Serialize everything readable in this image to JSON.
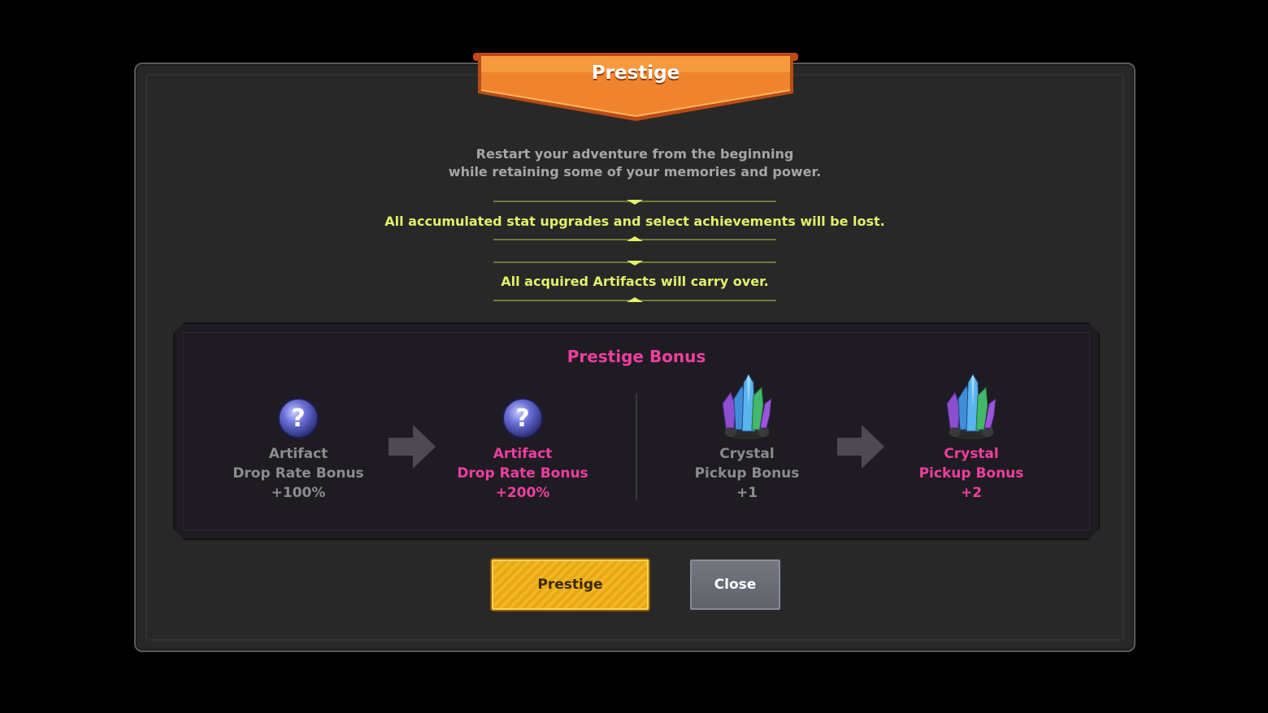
{
  "dialog": {
    "title": "Prestige",
    "description_line1": "Restart your adventure from the beginning",
    "description_line2": "while retaining some of your memories and power.",
    "warning": "All accumulated stat upgrades and select achievements will be lost.",
    "carry_over": "All acquired Artifacts will carry over."
  },
  "bonus": {
    "title": "Prestige Bonus",
    "items": [
      {
        "line1": "Artifact",
        "line2": "Drop Rate Bonus",
        "value": "+100%",
        "icon": "question-orb-icon",
        "state": "current"
      },
      {
        "line1": "Artifact",
        "line2": "Drop Rate Bonus",
        "value": "+200%",
        "icon": "question-orb-icon",
        "state": "next"
      },
      {
        "line1": "Crystal",
        "line2": "Pickup Bonus",
        "value": "+1",
        "icon": "crystal-cluster-icon",
        "state": "current"
      },
      {
        "line1": "Crystal",
        "line2": "Pickup Bonus",
        "value": "+2",
        "icon": "crystal-cluster-icon",
        "state": "next"
      }
    ]
  },
  "buttons": {
    "prestige_label": "Prestige",
    "close_label": "Close"
  },
  "colors": {
    "banner": "#e8722a",
    "accent_pink": "#ee3f9e",
    "notice_yellow": "#e3f06a",
    "prestige_button": "#f3b624",
    "close_button": "#6a6c75"
  }
}
